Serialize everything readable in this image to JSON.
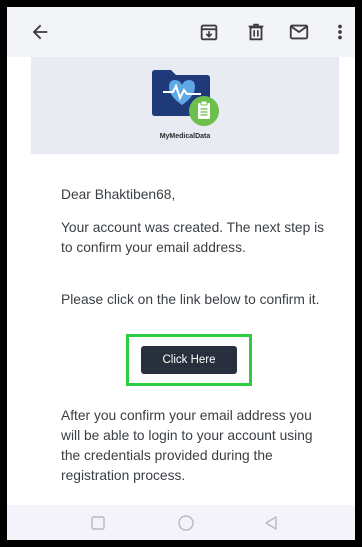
{
  "email": {
    "brand_name": "MyMedicalData",
    "greeting": "Dear Bhaktiben68,",
    "para1": "Your account was created. The next step is to confirm your email address.",
    "para2": "Please click on the link below to confirm it.",
    "button_label": "Click Here",
    "para3": "After you confirm your email address you will be able to login to your account using the credentials provided during the registration process."
  },
  "icons": {
    "back": "arrow-back-icon",
    "archive": "archive-icon",
    "delete": "trash-icon",
    "mail": "mail-icon",
    "more": "more-vertical-icon"
  },
  "colors": {
    "highlight": "#2ecc40",
    "button_bg": "#27303c",
    "banner_bg": "#e8ecf2"
  }
}
